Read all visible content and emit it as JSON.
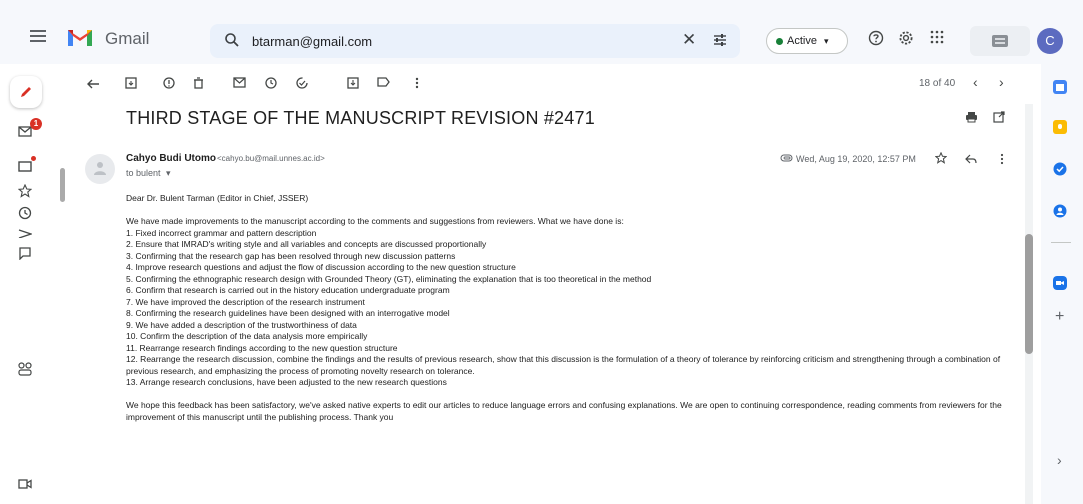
{
  "app": {
    "name": "Gmail",
    "avatar_letter": "C"
  },
  "search": {
    "value": "btarman@gmail.com",
    "clear_glyph": "✕"
  },
  "status": {
    "label": "Active",
    "arrow": "▾",
    "color": "#188038"
  },
  "rail": {
    "inbox_badge": "1"
  },
  "toolbar": {
    "pager_text": "18 of 40",
    "prev": "‹",
    "next": "›"
  },
  "email": {
    "subject": "THIRD STAGE OF THE MANUSCRIPT REVISION #2471",
    "sender_name": "Cahyo Budi Utomo",
    "sender_email": "<cahyo.bu@mail.unnes.ac.id>",
    "to_line": "to bulent",
    "to_arrow": "▾",
    "date": "Wed, Aug 19, 2020, 12:57 PM",
    "greeting": "Dear Dr. Bulent Tarman (Editor in Chief, JSSER)",
    "intro": "We have made improvements to the manuscript according to the comments and suggestions from reviewers. What we have done is:",
    "items": [
      "1. Fixed incorrect grammar and pattern description",
      "2. Ensure that IMRAD's writing style and all variables and concepts are discussed proportionally",
      "3. Confirming that the research gap has been resolved through new discussion patterns",
      "4. Improve research questions and adjust the flow of discussion according to the new question structure",
      "5. Confirming the ethnographic research design with Grounded Theory (GT), eliminating the explanation that is too theoretical in the method",
      "6. Confirm that research is carried out in the history education undergraduate program",
      "7. We have improved the description of the research instrument",
      "8. Confirming the research guidelines have been designed with an interrogative model",
      "9. We have added a description of the trustworthiness of data",
      "10. Confirm the description of the data analysis more empirically",
      "11. Rearrange research findings according to the new question structure",
      "12. Rearrange the research discussion, combine the findings and the results of previous research, show that this discussion is the formulation of a theory of tolerance by reinforcing criticism and strengthening through a combination of previous research, and emphasizing the process of promoting novelty research on tolerance.",
      "13. Arrange research conclusions, have been adjusted to the new research questions"
    ],
    "closing": "We hope this feedback has been satisfactory, we've asked native experts to edit our articles to reduce language errors and confusing explanations. We are open to continuing correspondence, reading comments from reviewers for the improvement of this manuscript until the publishing process. Thank you"
  },
  "colors": {
    "gmail_red": "#ea4335",
    "gmail_blue": "#4285f4",
    "gmail_green": "#34a853",
    "gmail_yellow": "#fbbc04",
    "background": "#f6f8fc"
  },
  "side_panel": {
    "expand_glyph": "›",
    "add_glyph": "+"
  }
}
